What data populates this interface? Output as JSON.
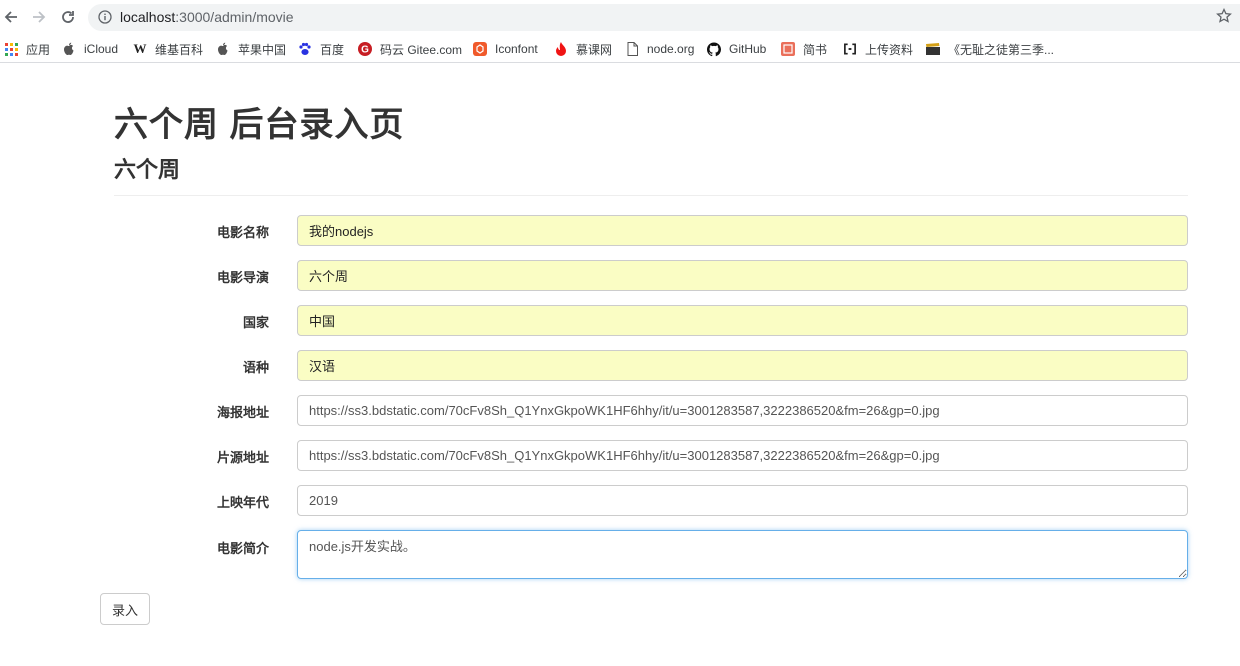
{
  "browser": {
    "url_host": "localhost",
    "url_rest": ":3000/admin/movie",
    "bookmarks": [
      "应用",
      "iCloud",
      "维基百科",
      "苹果中国",
      "百度",
      "码云 Gitee.com",
      "Iconfont",
      "慕课网",
      "node.org",
      "GitHub",
      "简书",
      "上传资料",
      "《无耻之徒第三季..."
    ]
  },
  "page": {
    "title": "六个周 后台录入页",
    "subtitle": "六个周"
  },
  "form": {
    "fields": [
      {
        "label": "电影名称",
        "value": "我的nodejs"
      },
      {
        "label": "电影导演",
        "value": "六个周"
      },
      {
        "label": "国家",
        "value": "中国"
      },
      {
        "label": "语种",
        "value": "汉语"
      },
      {
        "label": "海报地址",
        "value": "https://ss3.bdstatic.com/70cFv8Sh_Q1YnxGkpoWK1HF6hhy/it/u=3001283587,3222386520&fm=26&gp=0.jpg"
      },
      {
        "label": "片源地址",
        "value": "https://ss3.bdstatic.com/70cFv8Sh_Q1YnxGkpoWK1HF6hhy/it/u=3001283587,3222386520&fm=26&gp=0.jpg"
      },
      {
        "label": "上映年代",
        "value": "2019"
      },
      {
        "label": "电影简介",
        "value": "node.js开发实战。"
      }
    ],
    "submit_label": "录入"
  },
  "colors": {
    "autofill": "#fafdc4",
    "focus_border": "#66afe9"
  }
}
